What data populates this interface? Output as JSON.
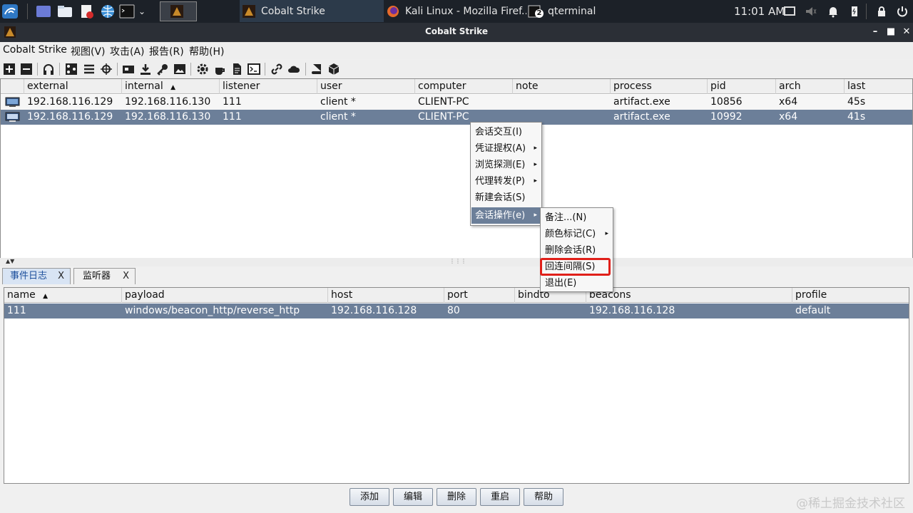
{
  "taskbar": {
    "tasks": [
      {
        "label": "Cobalt Strike"
      },
      {
        "label": "Kali Linux - Mozilla Firef..."
      },
      {
        "label": "qterminal"
      }
    ],
    "terminal_badge": "2",
    "clock": "11:01 AM"
  },
  "window": {
    "title": "Cobalt Strike"
  },
  "menubar": {
    "items": [
      {
        "label": "Cobalt Strike"
      },
      {
        "label": "视图(V)"
      },
      {
        "label": "攻击(A)"
      },
      {
        "label": "报告(R)"
      },
      {
        "label": "帮助(H)"
      }
    ]
  },
  "sessions": {
    "columns": [
      "external",
      "internal",
      "listener",
      "user",
      "computer",
      "note",
      "process",
      "pid",
      "arch",
      "last"
    ],
    "sort_indicator": "▲",
    "rows": [
      {
        "external": "192.168.116.129",
        "internal": "192.168.116.130",
        "listener": "111",
        "user": "client *",
        "computer": "CLIENT-PC",
        "note": "",
        "process": "artifact.exe",
        "pid": "10856",
        "arch": "x64",
        "last": "45s"
      },
      {
        "external": "192.168.116.129",
        "internal": "192.168.116.130",
        "listener": "111",
        "user": "client *",
        "computer": "CLIENT-PC",
        "note": "",
        "process": "artifact.exe",
        "pid": "10992",
        "arch": "x64",
        "last": "41s"
      }
    ]
  },
  "context_menu": {
    "items": [
      {
        "label": "会话交互(I)"
      },
      {
        "label": "凭证提权(A)"
      },
      {
        "label": "浏览探测(E)"
      },
      {
        "label": "代理转发(P)"
      },
      {
        "label": "新建会话(S)"
      },
      {
        "label": "会话操作(e)"
      }
    ]
  },
  "submenu": {
    "items": [
      {
        "label": "备注...(N)"
      },
      {
        "label": "颜色标记(C)"
      },
      {
        "label": "删除会话(R)"
      },
      {
        "label": "回连间隔(S)"
      },
      {
        "label": "退出(E)"
      }
    ]
  },
  "tabs": [
    {
      "label": "事件日志",
      "close": "X"
    },
    {
      "label": "监听器",
      "close": "X"
    }
  ],
  "listeners": {
    "columns": [
      "name",
      "payload",
      "host",
      "port",
      "bindto",
      "beacons",
      "profile"
    ],
    "sort_indicator": "▲",
    "rows": [
      {
        "name": "111",
        "payload": "windows/beacon_http/reverse_http",
        "host": "192.168.116.128",
        "port": "80",
        "bindto": "",
        "beacons": "192.168.116.128",
        "profile": "default"
      }
    ]
  },
  "buttons": {
    "add": "添加",
    "edit": "编辑",
    "remove": "删除",
    "restart": "重启",
    "help": "帮助"
  },
  "watermark": "@稀土掘金技术社区",
  "colors": {
    "selection": "#6c7f99",
    "highlight_box": "#e0201a",
    "taskbar": "#1c2128"
  }
}
